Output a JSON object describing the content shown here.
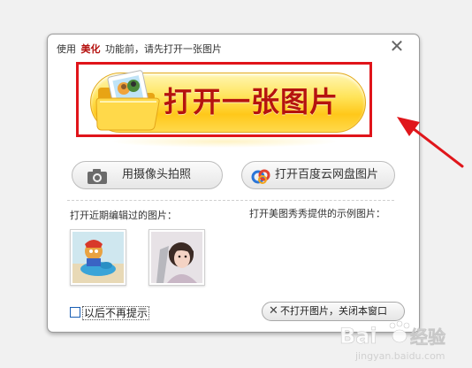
{
  "dialog": {
    "title_prefix": "使用",
    "title_accent": "美化",
    "title_suffix": "功能前，请先打开一张图片",
    "close_symbol": "✕"
  },
  "main_button": {
    "label": "打开一张图片",
    "icon": "folder-photo-icon"
  },
  "camera_button": {
    "label": "用摄像头拍照",
    "icon": "camera-icon"
  },
  "cloud_button": {
    "label": "打开百度云网盘图片",
    "icon": "baidu-cloud-icon"
  },
  "recent": {
    "label": "打开近期编辑过的图片："
  },
  "samples": {
    "label": "打开美图秀秀提供的示例图片："
  },
  "footer": {
    "dont_show_label": "以后不再提示",
    "skip_label": "不打开图片，关闭本窗口",
    "skip_symbol": "✕"
  },
  "watermark": {
    "brand": "Bai",
    "brand_suffix": "经验",
    "url": "jingyan.baidu.com"
  },
  "colors": {
    "accent_red": "#b5120f",
    "highlight_red": "#e0141a",
    "button_yellow": "#ffd630",
    "arrow_red": "#e0161b"
  }
}
